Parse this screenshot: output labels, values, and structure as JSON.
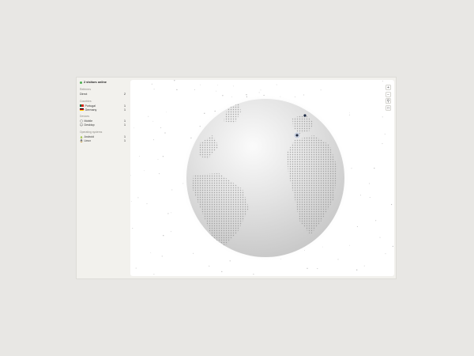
{
  "header": {
    "online_text": "2 visitors online"
  },
  "sections": [
    {
      "title": "Referrers",
      "items": [
        {
          "label": "Direct",
          "count": "2"
        }
      ]
    },
    {
      "title": "Countries",
      "items": [
        {
          "label": "Portugal",
          "count": "1",
          "icon": "flag-portugal"
        },
        {
          "label": "Germany",
          "count": "1",
          "icon": "flag-germany"
        }
      ]
    },
    {
      "title": "Devices",
      "items": [
        {
          "label": "Mobile",
          "count": "1",
          "icon": "mobile-icon"
        },
        {
          "label": "Desktop",
          "count": "1",
          "icon": "desktop-icon"
        }
      ]
    },
    {
      "title": "Operating systems",
      "items": [
        {
          "label": "Android",
          "count": "1",
          "icon": "android-icon"
        },
        {
          "label": "Linux",
          "count": "1",
          "icon": "linux-icon"
        }
      ]
    }
  ],
  "controls": {
    "zoom_in": "+",
    "zoom_out": "−",
    "person": "⚲",
    "expand": "□"
  },
  "colors": {
    "online_dot": "#4caf50",
    "visitor_marker": "#1d2a44"
  }
}
